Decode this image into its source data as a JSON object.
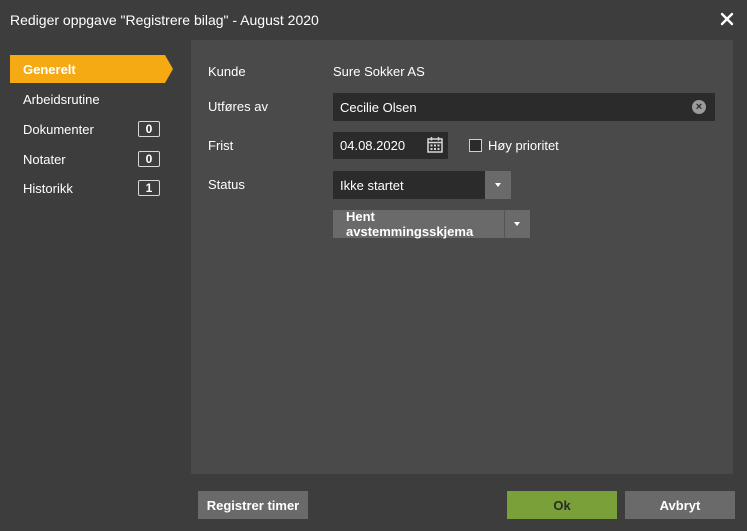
{
  "window": {
    "title": "Rediger oppgave \"Registrere bilag\" - August 2020"
  },
  "sidebar": {
    "items": [
      {
        "label": "Generelt",
        "active": true
      },
      {
        "label": "Arbeidsrutine"
      },
      {
        "label": "Dokumenter",
        "badge": "0"
      },
      {
        "label": "Notater",
        "badge": "0"
      },
      {
        "label": "Historikk",
        "badge": "1"
      }
    ]
  },
  "form": {
    "customer_label": "Kunde",
    "customer_value": "Sure Sokker AS",
    "performed_by_label": "Utføres av",
    "performed_by_value": "Cecilie Olsen",
    "deadline_label": "Frist",
    "deadline_value": "04.08.2020",
    "priority_label": "Høy prioritet",
    "priority_checked": false,
    "status_label": "Status",
    "status_value": "Ikke startet",
    "fetch_button_label": "Hent avstemmingsskjema"
  },
  "footer": {
    "register_hours_label": "Registrer timer",
    "ok_label": "Ok",
    "cancel_label": "Avbryt"
  },
  "colors": {
    "accent": "#f5a912",
    "ok": "#7aa03a",
    "panel": "#4a4a4a",
    "background": "#3d3d3d",
    "field": "#2b2b2b"
  }
}
